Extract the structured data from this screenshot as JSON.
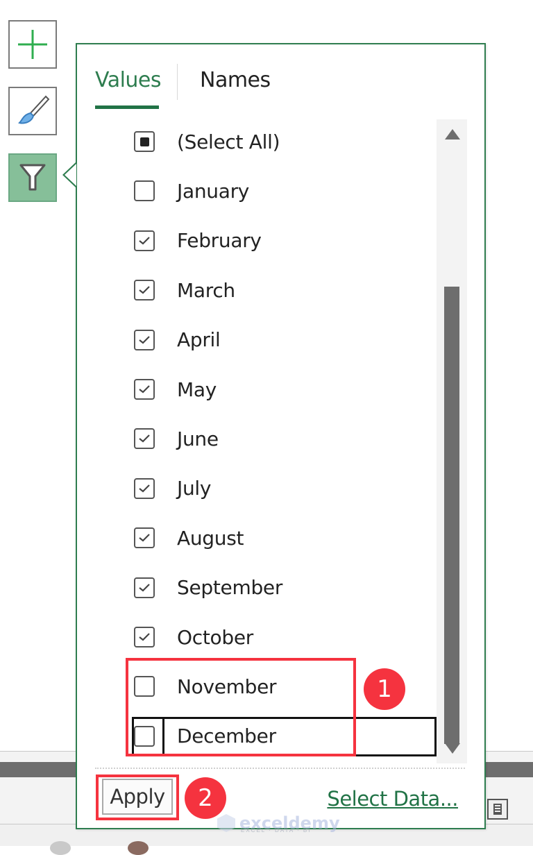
{
  "side_buttons": [
    {
      "name": "chart-elements",
      "icon": "plus-icon"
    },
    {
      "name": "chart-styles",
      "icon": "paintbrush-icon"
    },
    {
      "name": "chart-filters",
      "icon": "funnel-icon",
      "active": true
    }
  ],
  "filter_panel": {
    "tabs": [
      {
        "label": "Values",
        "active": true
      },
      {
        "label": "Names",
        "active": false
      }
    ],
    "items": [
      {
        "label": "(Select All)",
        "state": "indeterminate"
      },
      {
        "label": "January",
        "state": "unchecked"
      },
      {
        "label": "February",
        "state": "checked"
      },
      {
        "label": "March",
        "state": "checked"
      },
      {
        "label": "April",
        "state": "checked"
      },
      {
        "label": "May",
        "state": "checked"
      },
      {
        "label": "June",
        "state": "checked"
      },
      {
        "label": "July",
        "state": "checked"
      },
      {
        "label": "August",
        "state": "checked"
      },
      {
        "label": "September",
        "state": "checked"
      },
      {
        "label": "October",
        "state": "checked"
      },
      {
        "label": "November",
        "state": "unchecked"
      },
      {
        "label": "December",
        "state": "unchecked",
        "focused": true
      }
    ],
    "scrollbar": {
      "thumb_start": 0.26,
      "thumb_end": 0.97
    },
    "apply_label": "Apply",
    "select_data_label": "Select Data..."
  },
  "annotations": [
    {
      "number": "1",
      "target": "November and December unchecked"
    },
    {
      "number": "2",
      "target": "Apply button"
    }
  ],
  "colors": {
    "accent_green": "#217346",
    "annotation_red": "#f5333f",
    "filter_button_bg": "#86bf99"
  },
  "watermark": {
    "brand": "exceldemy",
    "tagline": "EXCEL · DATA · BI"
  }
}
